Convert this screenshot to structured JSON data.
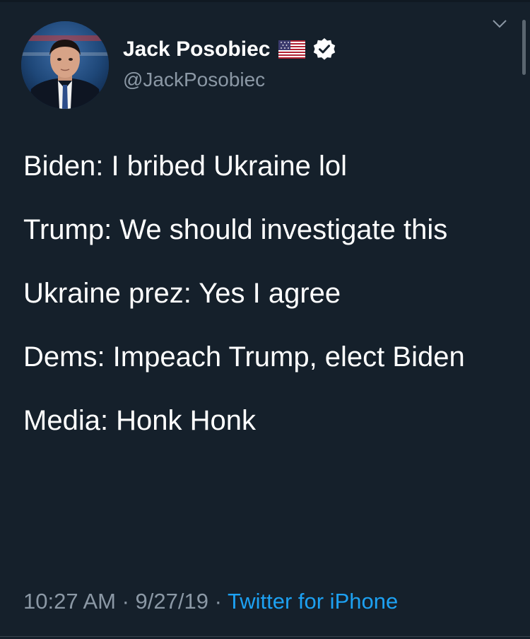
{
  "tweet": {
    "author": {
      "display_name": "Jack Posobiec",
      "handle": "@JackPosobiec",
      "flag_icon": "us-flag-icon",
      "verified_icon": "verified-badge-icon"
    },
    "body_lines": [
      "Biden: I bribed Ukraine lol",
      "Trump: We should investigate this",
      "Ukraine prez: Yes I agree",
      "Dems: Impeach Trump, elect Biden",
      "Media: Honk Honk"
    ],
    "meta": {
      "time": "10:27 AM",
      "separator": " · ",
      "date": "9/27/19",
      "source": "Twitter for iPhone"
    }
  },
  "icons": {
    "menu": "chevron-down-icon"
  },
  "colors": {
    "background": "#15202b",
    "text_primary": "#ffffff",
    "text_secondary": "#8b98a5",
    "link": "#1da1f2"
  }
}
